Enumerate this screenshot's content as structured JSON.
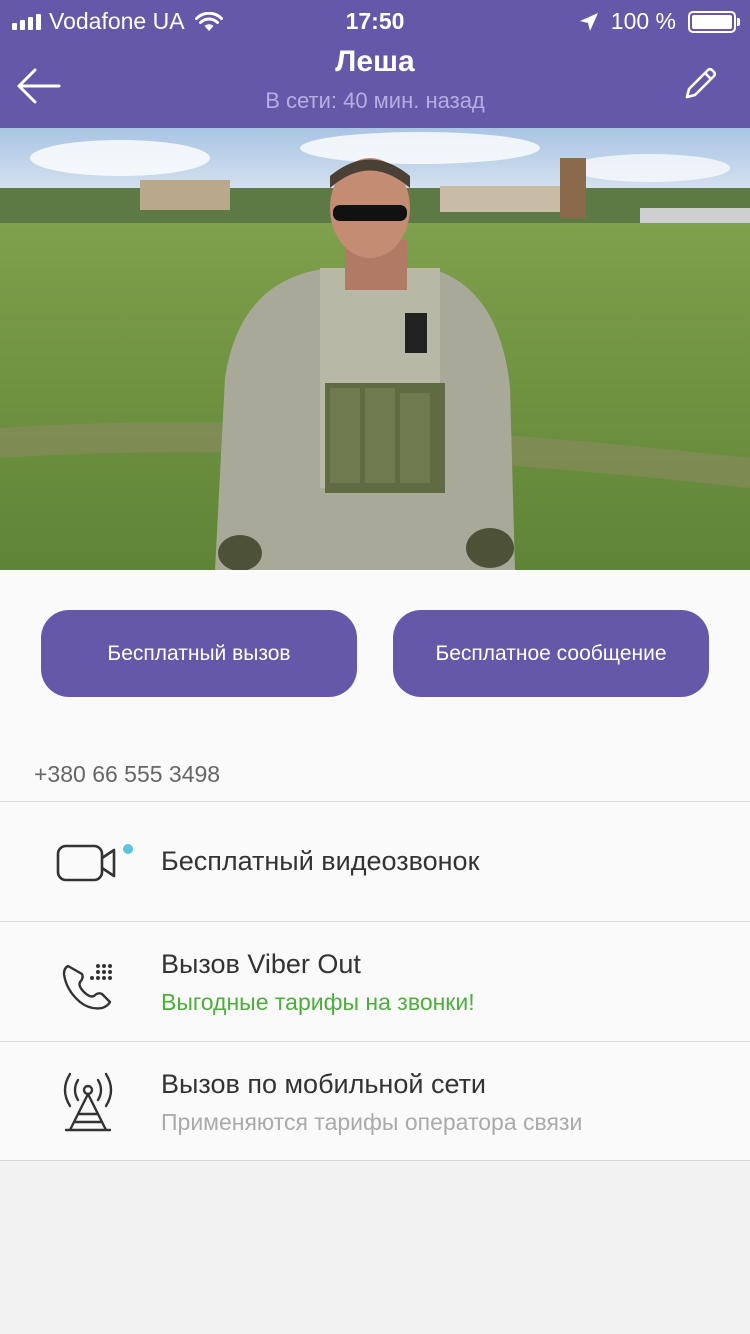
{
  "status_bar": {
    "carrier": "Vodafone UA",
    "time": "17:50",
    "battery": "100 %",
    "icons": [
      "signal-icon",
      "wifi-icon",
      "location-arrow-icon",
      "battery-icon"
    ]
  },
  "nav": {
    "title": "Леша",
    "subtitle": "В сети: 40 мин. назад",
    "back_icon": "back-arrow-icon",
    "edit_icon": "pencil-icon"
  },
  "actions": {
    "call_label": "Бесплатный вызов",
    "message_label": "Бесплатное сообщение",
    "phone_number": "+380 66 555 3498"
  },
  "options": [
    {
      "icon": "video-camera-icon",
      "title": "Бесплатный видеозвонок",
      "subtitle": ""
    },
    {
      "icon": "viber-out-phone-icon",
      "title": "Вызов Viber Out",
      "subtitle": "Выгодные тарифы на звонки!"
    },
    {
      "icon": "cell-tower-icon",
      "title": "Вызов по мобильной сети",
      "subtitle": "Применяются тарифы оператора связи"
    }
  ],
  "colors": {
    "header": "#6558a8",
    "button": "#6558a8",
    "accent_green": "#4cae3b",
    "online_dot": "#5bc4e0"
  }
}
